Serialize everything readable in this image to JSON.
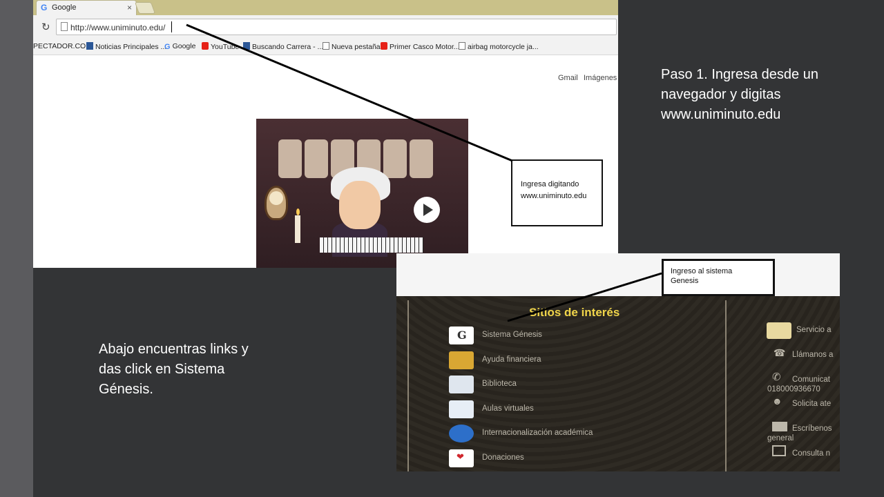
{
  "browser": {
    "tab_title": "Google",
    "tab_icon": "G",
    "tab_close": "×",
    "url": "http://www.uniminuto.edu/",
    "bookmarks": [
      "PECTADOR.COM",
      "Noticias Principales ...",
      "Google",
      "YouTube",
      "Buscando Carrera - ...",
      "Nueva pestaña",
      "Primer Casco Motor...",
      "airbag motorcycle ja..."
    ],
    "gmail": "Gmail",
    "imagenes": "Imágenes",
    "icons": {
      "reload": "reload-icon",
      "page": "page-icon",
      "play": "play-icon"
    }
  },
  "callout1": {
    "line1": "Ingresa digitando",
    "line2": "www.uniminuto.edu"
  },
  "callout2": {
    "line1": "Ingreso al sistema",
    "line2": "Genesis"
  },
  "sites": {
    "title": "Sitios de interés",
    "items": [
      "Sistema Génesis",
      "Ayuda financiera",
      "Biblioteca",
      "Aulas virtuales",
      "Internacionalización académica",
      "Donaciones"
    ],
    "right_items": [
      "Servicio a",
      "Llámanos a",
      "Comunicat",
      "018000936670",
      "Solicita ate",
      "Escríbenos",
      "general",
      "Consulta n"
    ]
  },
  "slide": {
    "step1_line1": "Paso 1. Ingresa desde un",
    "step1_line2": "navegador y digitas",
    "step1_line3": "www.uniminuto.edu",
    "step2_line1": "Abajo encuentras links y",
    "step2_line2": "das click en Sistema",
    "step2_line3": "Génesis."
  },
  "colors": {
    "background": "#333436",
    "sites_title": "#f0d54a",
    "tabbar": "#c9c189"
  }
}
